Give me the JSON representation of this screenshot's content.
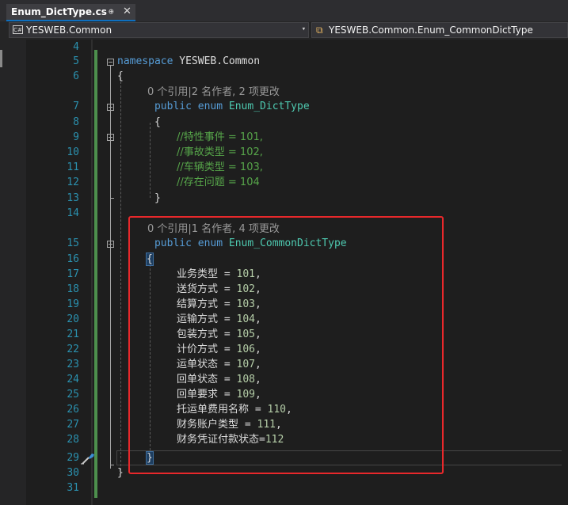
{
  "tab": {
    "title": "Enum_DictType.cs",
    "pin": "⊕",
    "close": "✕"
  },
  "nav": {
    "project_icon": "C#",
    "project": "YESWEB.Common",
    "member": "YESWEB.Common.Enum_CommonDictType"
  },
  "editor": {
    "line_numbers": [
      "4",
      "5",
      "6",
      "7",
      "8",
      "9",
      "10",
      "11",
      "12",
      "13",
      "14",
      "15",
      "16",
      "17",
      "18",
      "19",
      "20",
      "21",
      "22",
      "23",
      "24",
      "25",
      "26",
      "27",
      "28",
      "29",
      "30",
      "31"
    ],
    "line_number_tops": [],
    "codelens": {
      "first": "0 个引用|2 名作者, 2 项更改",
      "second": "0 个引用|1 名作者, 4 项更改"
    },
    "code": {
      "ns_kw": "namespace",
      "ns_name": "YESWEB.Common",
      "open_brace": "{",
      "close_brace": "}",
      "public_kw": "public",
      "enum_kw": "enum",
      "enum1_name": "Enum_DictType",
      "enum2_name": "Enum_CommonDictType",
      "enum1_comments": [
        "//特性事件 = 101,",
        "//事故类型 = 102,",
        "//车辆类型 = 103,",
        "//存在问题 = 104"
      ],
      "enum2_members": [
        {
          "name": "业务类型",
          "sep": " = ",
          "value": "101",
          "tail": ","
        },
        {
          "name": "送货方式",
          "sep": " = ",
          "value": "102",
          "tail": ","
        },
        {
          "name": "结算方式",
          "sep": " = ",
          "value": "103",
          "tail": ","
        },
        {
          "name": "运输方式",
          "sep": " = ",
          "value": "104",
          "tail": ","
        },
        {
          "name": "包装方式",
          "sep": " = ",
          "value": "105",
          "tail": ","
        },
        {
          "name": "计价方式",
          "sep": " = ",
          "value": "106",
          "tail": ","
        },
        {
          "name": "运单状态",
          "sep": " = ",
          "value": "107",
          "tail": ","
        },
        {
          "name": "回单状态",
          "sep": " = ",
          "value": "108",
          "tail": ","
        },
        {
          "name": "回单要求",
          "sep": " = ",
          "value": "109",
          "tail": ","
        },
        {
          "name": "托运单费用名称",
          "sep": " = ",
          "value": "110",
          "tail": ","
        },
        {
          "name": "财务账户类型",
          "sep": " = ",
          "value": "111",
          "tail": ","
        },
        {
          "name": "财务凭证付款状态",
          "sep": "=",
          "value": "112",
          "tail": ""
        }
      ]
    }
  },
  "colors": {
    "keyword": "#569cd6",
    "type": "#4ec9b0",
    "comment": "#57a64a",
    "number": "#b5cea8",
    "line_number": "#2b91af",
    "annotation": "#e8282b"
  }
}
